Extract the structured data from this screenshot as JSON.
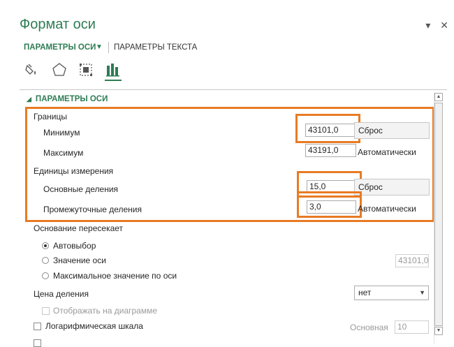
{
  "panel": {
    "title": "Формат оси",
    "pin_icon": "chevron-down-icon",
    "close_icon": "close-icon",
    "pin_glyph": "▾",
    "close_glyph": "✕"
  },
  "tabs": {
    "axis_options": "ПАРАМЕТРЫ ОСИ",
    "axis_arrow": "▼",
    "text_options": "ПАРАМЕТРЫ ТЕКСТА"
  },
  "icon_tabs": [
    "fill-line-icon",
    "effects-icon",
    "size-properties-icon",
    "axis-options-icon"
  ],
  "section": {
    "arrow": "◢",
    "title": "ПАРАМЕТРЫ ОСИ"
  },
  "bounds": {
    "heading": "Границы",
    "minimum_label": "Минимум",
    "minimum_value": "43101,0",
    "minimum_action": "Сброс",
    "maximum_label": "Максимум",
    "maximum_value": "43191,0",
    "maximum_action": "Автоматически"
  },
  "units": {
    "heading": "Единицы измерения",
    "major_label": "Основные деления",
    "major_value": "15,0",
    "major_action": "Сброс",
    "minor_label": "Промежуточные деления",
    "minor_value": "3,0",
    "minor_action": "Автоматически"
  },
  "crosses": {
    "heading": "Основание пересекает",
    "auto_label": "Автовыбор",
    "value_label": "Значение оси",
    "value_field": "43101,0",
    "max_label": "Максимальное значение по оси"
  },
  "tick": {
    "label": "Цена деления",
    "select_value": "нет",
    "select_caret": "▼",
    "show_on_chart": "Отображать на диаграмме"
  },
  "log": {
    "label": "Логарифмическая шкала",
    "base_label": "Основная",
    "base_value": "10"
  },
  "scroll": {
    "up": "▲",
    "down": "▼"
  },
  "colors": {
    "accent": "#2e7c54",
    "highlight": "#e87b24"
  }
}
